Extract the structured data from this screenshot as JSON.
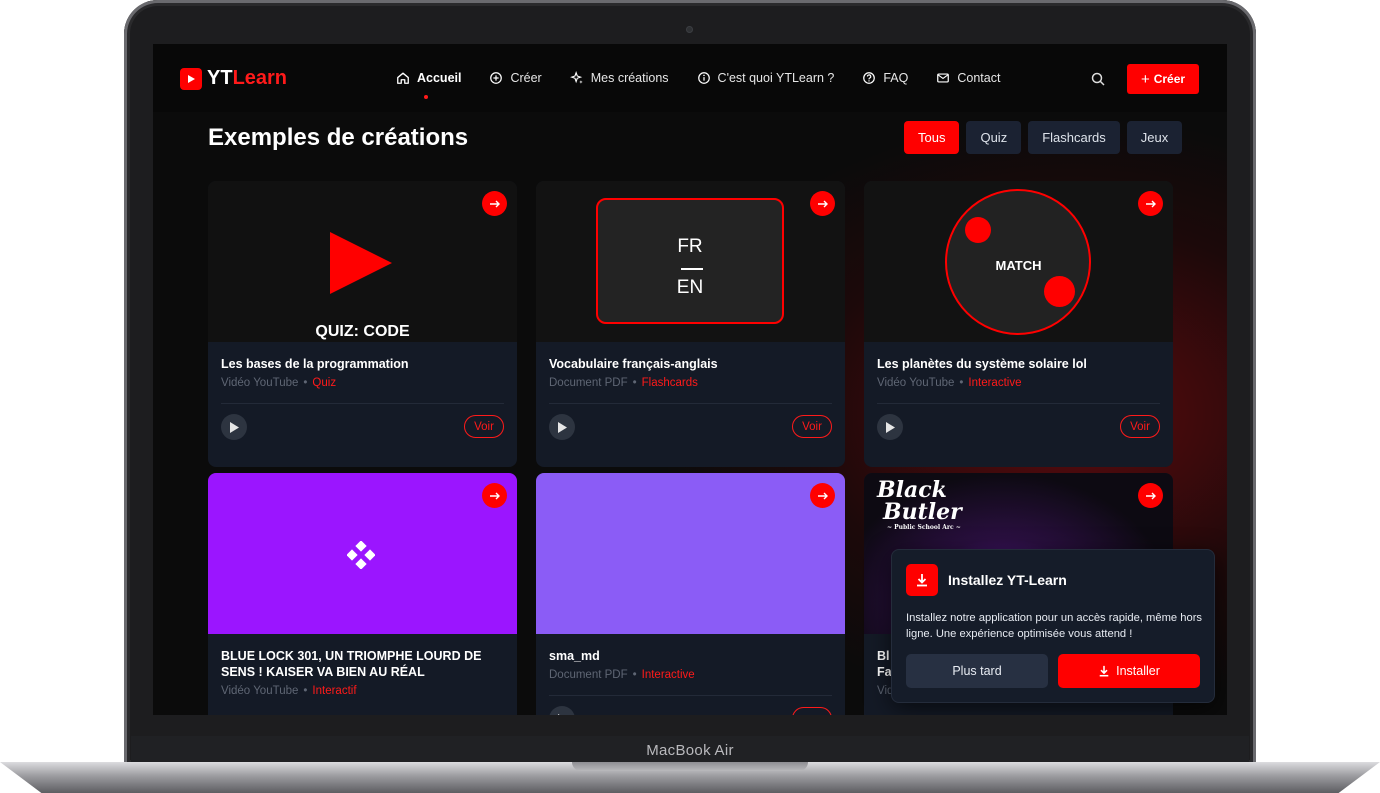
{
  "device": {
    "label": "MacBook Air"
  },
  "brand": {
    "prefix": "YT",
    "suffix": "Learn",
    "accent": "#ff0000"
  },
  "nav": {
    "items": [
      {
        "label": "Accueil",
        "icon": "home-icon",
        "active": true
      },
      {
        "label": "Créer",
        "icon": "plus-circle-icon"
      },
      {
        "label": "Mes créations",
        "icon": "sparkles-icon"
      },
      {
        "label": "C'est quoi YTLearn ?",
        "icon": "info-icon"
      },
      {
        "label": "FAQ",
        "icon": "help-icon"
      },
      {
        "label": "Contact",
        "icon": "mail-icon"
      }
    ],
    "search_icon": "search-icon",
    "create_label": "Créer"
  },
  "section": {
    "title": "Exemples de créations"
  },
  "filters": [
    {
      "label": "Tous",
      "active": true
    },
    {
      "label": "Quiz"
    },
    {
      "label": "Flashcards"
    },
    {
      "label": "Jeux"
    }
  ],
  "cards": [
    {
      "thumb_caption": "QUIZ: CODE",
      "title": "Les bases de la programmation",
      "source": "Vidéo YouTube",
      "type": "Quiz",
      "action": "Voir"
    },
    {
      "thumb_top": "FR",
      "thumb_bottom": "EN",
      "title": "Vocabulaire français-anglais",
      "source": "Document PDF",
      "type": "Flashcards",
      "action": "Voir"
    },
    {
      "thumb_caption": "MATCH",
      "title": "Les planètes du système solaire lol",
      "source": "Vidéo YouTube",
      "type": "Interactive",
      "action": "Voir"
    },
    {
      "title": "BLUE LOCK 301, UN TRIOMPHE LOURD DE SENS ! KAISER VA BIEN AU RÉAL",
      "source": "Vidéo YouTube",
      "type": "Interactif",
      "thumb_color": "#9b15ff"
    },
    {
      "title": "sma_md",
      "source": "Document PDF",
      "type": "Interactive",
      "thumb_color": "#8b5cf6"
    },
    {
      "thumb_logo_line1": "Black",
      "thumb_logo_line2": "Butler",
      "thumb_logo_line3": "~ Public School Arc ~",
      "title": "Bl",
      "title_line2": "Fa",
      "source": "Vid"
    }
  ],
  "install_popup": {
    "title": "Installez YT-Learn",
    "text": "Installez notre application pour un accès rapide, même hors ligne. Une expérience optimisée vous attend !",
    "later_label": "Plus tard",
    "install_label": "Installer"
  }
}
